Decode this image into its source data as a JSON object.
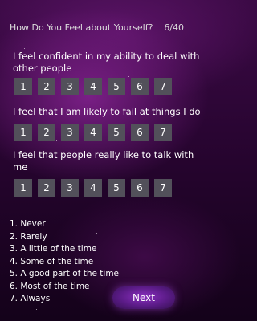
{
  "header": {
    "title": "How Do You Feel about Yourself?",
    "counter": "6/40"
  },
  "questions": [
    {
      "text_line1": "I feel confident in my ability to deal with",
      "text_line2": "other people",
      "options": [
        "1",
        "2",
        "3",
        "4",
        "5",
        "6",
        "7"
      ]
    },
    {
      "text_line1": "I feel that I am likely to fail at things I do",
      "options": [
        "1",
        "2",
        "3",
        "4",
        "5",
        "6",
        "7"
      ]
    },
    {
      "text_line1": "I feel that people really like to talk with",
      "text_line2": "me",
      "options": [
        "1",
        "2",
        "3",
        "4",
        "5",
        "6",
        "7"
      ]
    }
  ],
  "legend": [
    "1. Never",
    "2. Rarely",
    "3. A little of the time",
    "4. Some of the time",
    "5. A good part of the time",
    "6. Most of the time",
    "7. Always"
  ],
  "next_label": "Next",
  "colors": {
    "button_bg": "#52505a",
    "background": "#2a0533",
    "accent": "#8b2fc0"
  }
}
